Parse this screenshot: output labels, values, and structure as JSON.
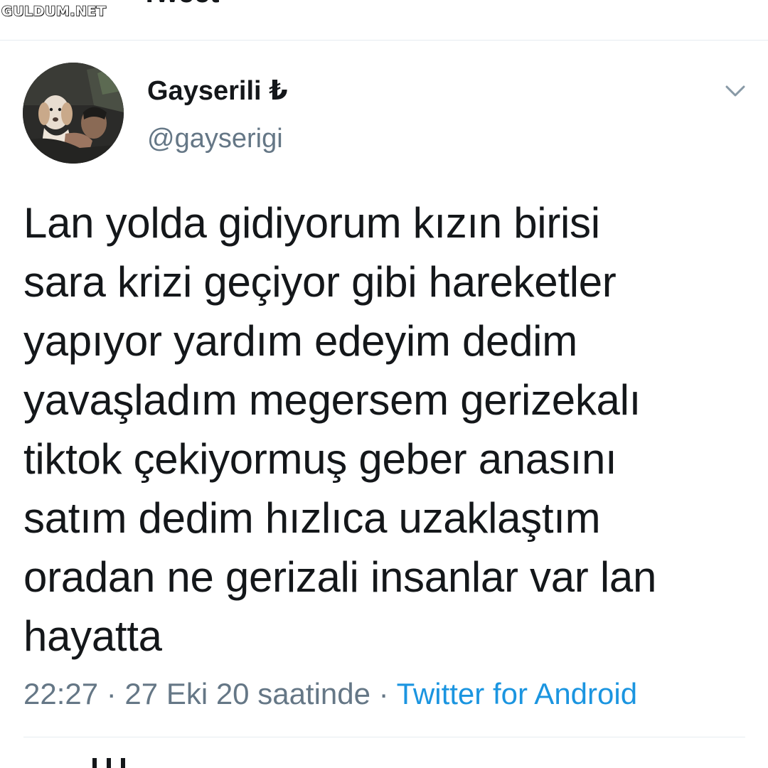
{
  "watermark": "GULDUM.NET",
  "header": {
    "title": "Tweet"
  },
  "user": {
    "display_name": "Gayserili ₺",
    "handle": "@gayserigi"
  },
  "tweet": {
    "lines": [
      "Lan yolda gidiyorum kızın birisi",
      "sara krizi geçiyor gibi hareketler",
      "yapıyor yardım edeyim dedim",
      "yavaşladım megersem gerizekalı",
      "tiktok çekiyormuş geber anasını",
      "satım dedim hızlıca uzaklaştım",
      "oradan ne gerizali insanlar var lan",
      "hayatta"
    ]
  },
  "meta": {
    "timestamp": "22:27 · 27 Eki 20 saatinde ·",
    "source": "Twitter for Android"
  },
  "icons": {
    "more": "chevron-down-icon",
    "avatar": "profile-photo"
  },
  "colors": {
    "text": "#14171a",
    "secondary": "#657786",
    "link": "#1b95e0",
    "divider": "#e6ecf0"
  }
}
